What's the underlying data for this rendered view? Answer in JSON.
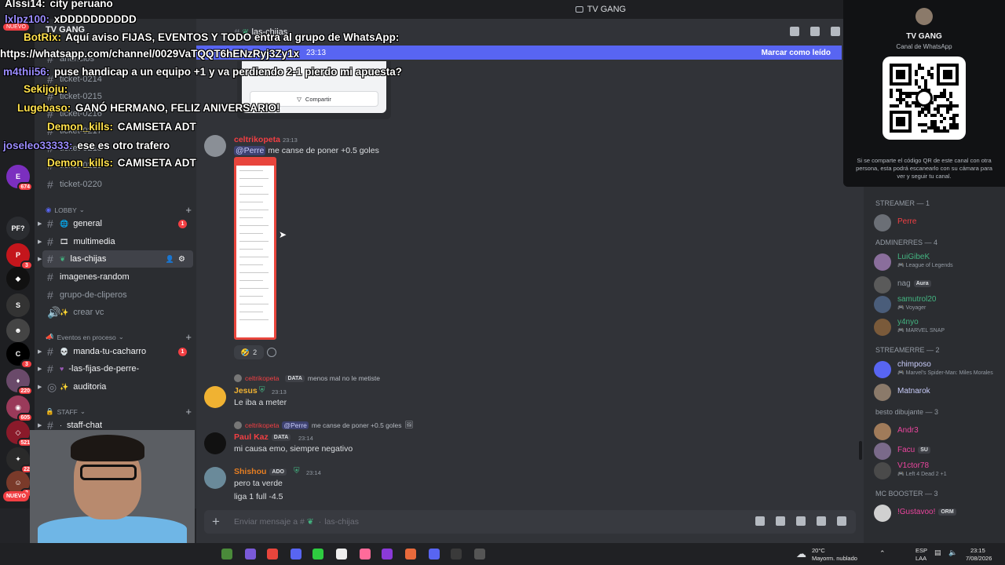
{
  "titlebar": {
    "title": "TV GANG"
  },
  "server": {
    "name": "TV GANG"
  },
  "channels": {
    "announcements": "anuncios",
    "tickets": [
      "ticket-0214",
      "ticket-0215",
      "ticket-0216",
      "ticket-0217",
      "ticket-0218",
      "ticket-0219",
      "ticket-0220"
    ],
    "lobby_label": "LOBBY",
    "lobby": [
      {
        "name": "general",
        "badge": "1"
      },
      {
        "name": "multimedia",
        "badge": ""
      },
      {
        "name": "las-chijas",
        "badge": ""
      },
      {
        "name": "imagenes-random",
        "badge": ""
      },
      {
        "name": "grupo-de-cliperos",
        "badge": ""
      },
      {
        "name": "crear vc",
        "badge": ""
      }
    ],
    "events_label": "Eventos en proceso",
    "events": [
      {
        "name": "manda-tu-cacharro",
        "badge": "1"
      },
      {
        "name": "-las-fijas-de-perre-",
        "badge": ""
      },
      {
        "name": "auditoria",
        "badge": ""
      }
    ],
    "staff_label": "STAFF",
    "staff": [
      {
        "name": "staff-chat",
        "badge": "6"
      }
    ]
  },
  "rail": {
    "badges": [
      "674",
      "3",
      "3",
      "220",
      "605",
      "521",
      "22",
      "3"
    ],
    "new_label": "NUEVO",
    "pf_label": "PF?"
  },
  "chat": {
    "channel_name": "las-chijas",
    "unread_time": "23:13",
    "unread_mark": "Marcar como leído",
    "share_label": "Compartir",
    "msg1": {
      "author": "celtrikopeta",
      "time": "23:13",
      "mention": "@Perre",
      "text": " me canse de poner +0.5 goles"
    },
    "reaction_count": "2",
    "msg2": {
      "reply_name": "celtrikopeta",
      "reply_badge": "DATA",
      "reply_text": "menos mal no le metiste",
      "author": "Jesus",
      "time": "23:13",
      "text": "Le iba a meter"
    },
    "msg3": {
      "reply_name": "celtrikopeta",
      "reply_mention": "@Perre",
      "reply_text": " me canse de poner +0.5 goles",
      "author": "Paul Kaz",
      "badge": "DATA",
      "time": "23:14",
      "text": "mi causa emo, siempre negativo"
    },
    "msg4": {
      "author": "Shishou",
      "badge": "ADO",
      "time": "23:14",
      "line1": "pero ta verde",
      "line2": "liga 1 full -4.5"
    },
    "composer_placeholder": "Enviar mensaje a #",
    "composer_channel": "las-chijas"
  },
  "whatsapp": {
    "title": "TV GANG",
    "subtitle": "Canal de WhatsApp",
    "note": "Si se comparte el código QR de este canal con otra persona, esta podrá escanearlo con su cámara para ver y seguir tu canal."
  },
  "members": {
    "groups": [
      {
        "label": "STREAMER — 1",
        "items": [
          {
            "name": "Perre",
            "activity": "",
            "color": "#f23f43",
            "avatar": "#6b6f76"
          }
        ]
      },
      {
        "label": "ADMINERRES — 4",
        "items": [
          {
            "name": "LuiGibeK",
            "activity": "League of Legends",
            "color": "#43b581",
            "avatar": "#8a6e9c"
          },
          {
            "name": "nag",
            "activity": "",
            "color": "#949ba4",
            "avatar": "#5a5a5a",
            "tag": "Aura"
          },
          {
            "name": "samutrol20",
            "activity": "Voyager",
            "color": "#43b581",
            "avatar": "#4a5d7a"
          },
          {
            "name": "y4nyo",
            "activity": "MARVEL SNAP",
            "color": "#43b581",
            "avatar": "#7a5a3a"
          }
        ]
      },
      {
        "label": "STREAMERRE — 2",
        "items": [
          {
            "name": "chimposo",
            "activity": "Marvel's Spider-Man: Miles Morales",
            "color": "#c9cdfb",
            "avatar": "#5865f2"
          },
          {
            "name": "Matnarok",
            "activity": "",
            "color": "#c9cdfb",
            "avatar": "#8b7a6a"
          }
        ]
      },
      {
        "label": "besto dibujante — 3",
        "items": [
          {
            "name": "Andr3",
            "activity": "",
            "color": "#eb459e",
            "avatar": "#a07b5a"
          },
          {
            "name": "Facu",
            "activity": "",
            "color": "#eb459e",
            "avatar": "#7a6a8a",
            "tag": "SU"
          },
          {
            "name": "V1ctor78",
            "activity": "Left 4 Dead 2 +1",
            "color": "#eb459e",
            "avatar": "#4a4a4a"
          }
        ]
      },
      {
        "label": "MC BOOSTER — 3",
        "items": [
          {
            "name": "!Gustavoo!",
            "activity": "",
            "color": "#eb459e",
            "avatar": "#d0d0d0",
            "tag": "ORM"
          }
        ]
      }
    ]
  },
  "overlay": [
    {
      "user": "Alssi14:",
      "text": " city peruano",
      "color": "#ffffff"
    },
    {
      "user": "lxlpz100:",
      "text": " xDDDDDDDDDD",
      "color": "#9b8cff"
    },
    {
      "user": "BotRix:",
      "text": " Aquí aviso FIJAS, EVENTOS Y TODO entra al grupo de WhatsApp:",
      "color": "#ffe14d"
    },
    {
      "user": "",
      "text": "https://whatsapp.com/channel/0029VaTQQT6hENzRyj3Zy1x",
      "color": "#ffffff"
    },
    {
      "user": "m4thii56:",
      "text": " puse handicap a un equipo +1 y va perdiendo 2-1 pierdo mi apuesta?",
      "color": "#9b8cff"
    },
    {
      "user": "Sekijoju:",
      "text": "",
      "color": "#ffe14d"
    },
    {
      "user": "Lugebaso:",
      "text": " GANÓ HERMANO, FELIZ ANIVERSARIO!",
      "color": "#ffe14d"
    },
    {
      "user": "Demon_kills:",
      "text": " CAMISETA ADT",
      "color": "#ffe14d"
    },
    {
      "user": "joseleo33333:",
      "text": " ese es otro trafero",
      "color": "#9b8cff"
    },
    {
      "user": "Demon_kills:",
      "text": " CAMISETA ADT",
      "color": "#ffe14d"
    }
  ],
  "overlay_new": "NUEVO",
  "taskbar": {
    "temp": "20°C",
    "weather": "Mayorm. nublado",
    "lang1": "ESP",
    "lang2": "LAA",
    "time": "23:15",
    "date": "7/08/2026"
  }
}
